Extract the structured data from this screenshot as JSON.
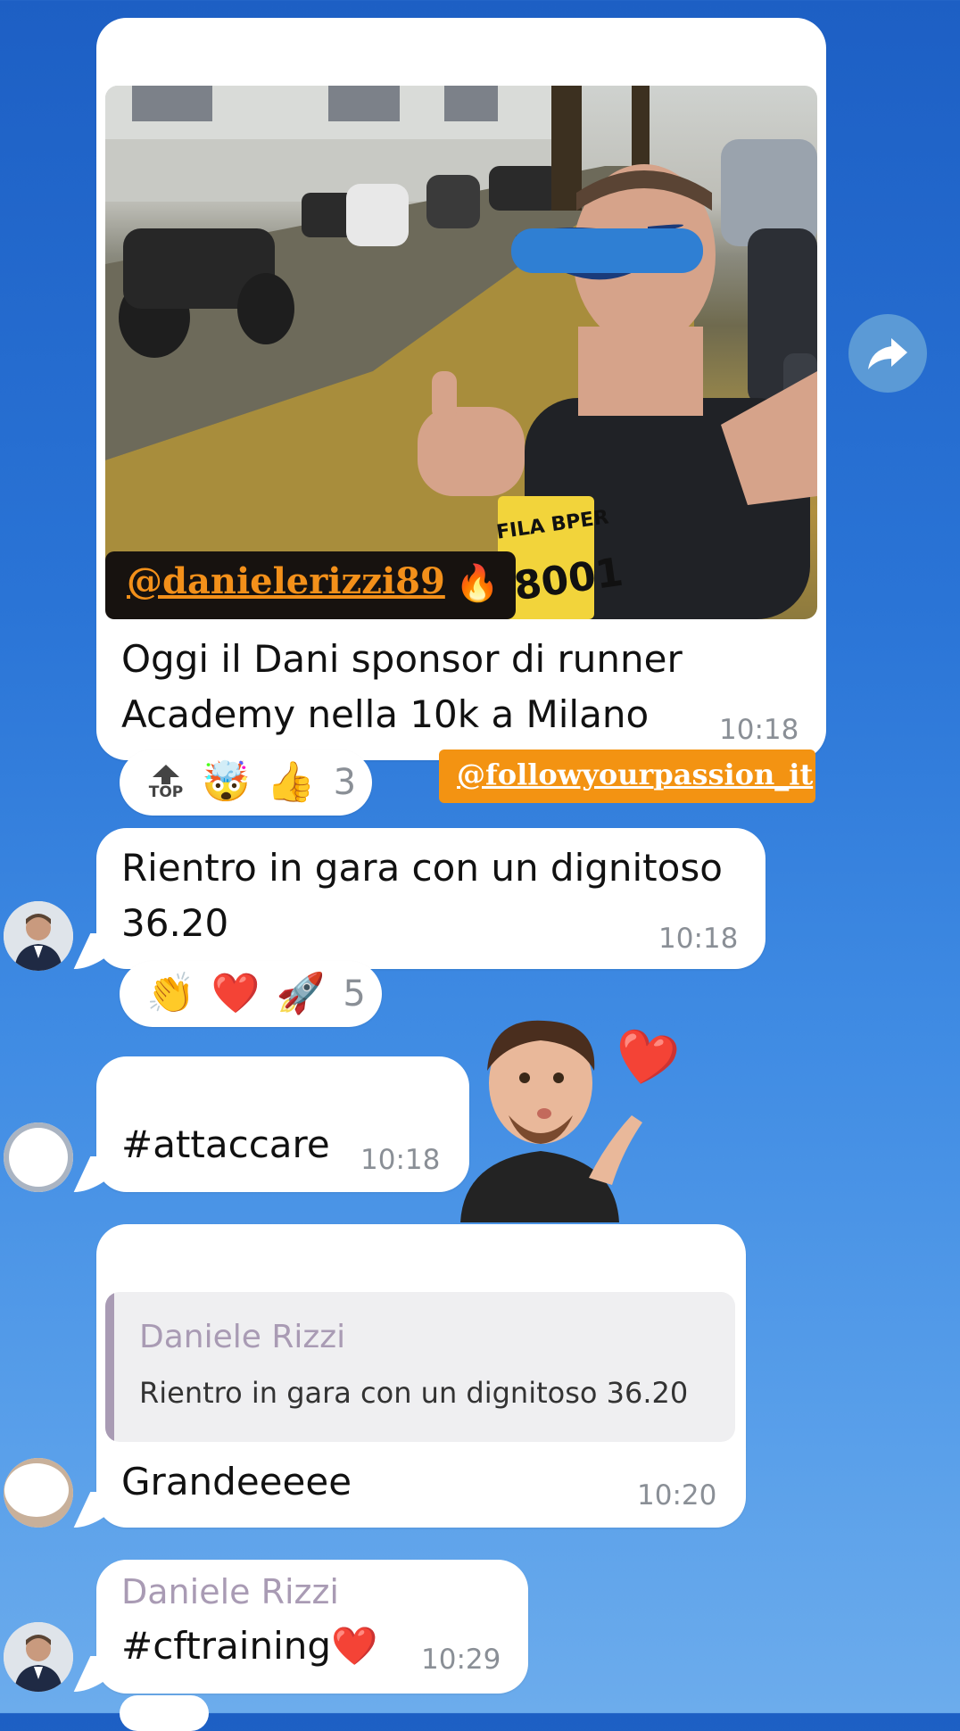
{
  "messages": [
    {
      "id": "photo-post",
      "photo": {
        "overlay_handle": "@danielerizzi89",
        "overlay_emoji": "🔥",
        "bib_brand": "FILA BPER",
        "bib_number": "8001"
      },
      "text": "Oggi il Dani sponsor di runner Academy nella 10k a Milano",
      "time": "10:18",
      "reactions": {
        "top_label": "TOP",
        "emojis": [
          "🤯",
          "👍"
        ],
        "count": "3"
      },
      "tag": "@followyourpassion_it"
    },
    {
      "id": "result",
      "text": "Rientro in gara con un dignitoso 36.20",
      "time": "10:18",
      "reactions": {
        "emojis": [
          "👏",
          "❤️",
          "🚀"
        ],
        "count": "5"
      }
    },
    {
      "id": "hashtag",
      "text": "#attaccare",
      "time": "10:18"
    },
    {
      "id": "reply",
      "quote": {
        "author": "Daniele Rizzi",
        "text": "Rientro in gara con un dignitoso 36.20"
      },
      "text": "Grandeeeee",
      "time": "10:20"
    },
    {
      "id": "last",
      "author": "Daniele Rizzi",
      "text": "#cftraining",
      "emoji": "❤️",
      "time": "10:29"
    }
  ],
  "sticker": {
    "heart": "❤️"
  },
  "colors": {
    "accent_purple": "#a99bb4",
    "tag_orange": "#f39312",
    "share_button": "#5b9ad6"
  }
}
